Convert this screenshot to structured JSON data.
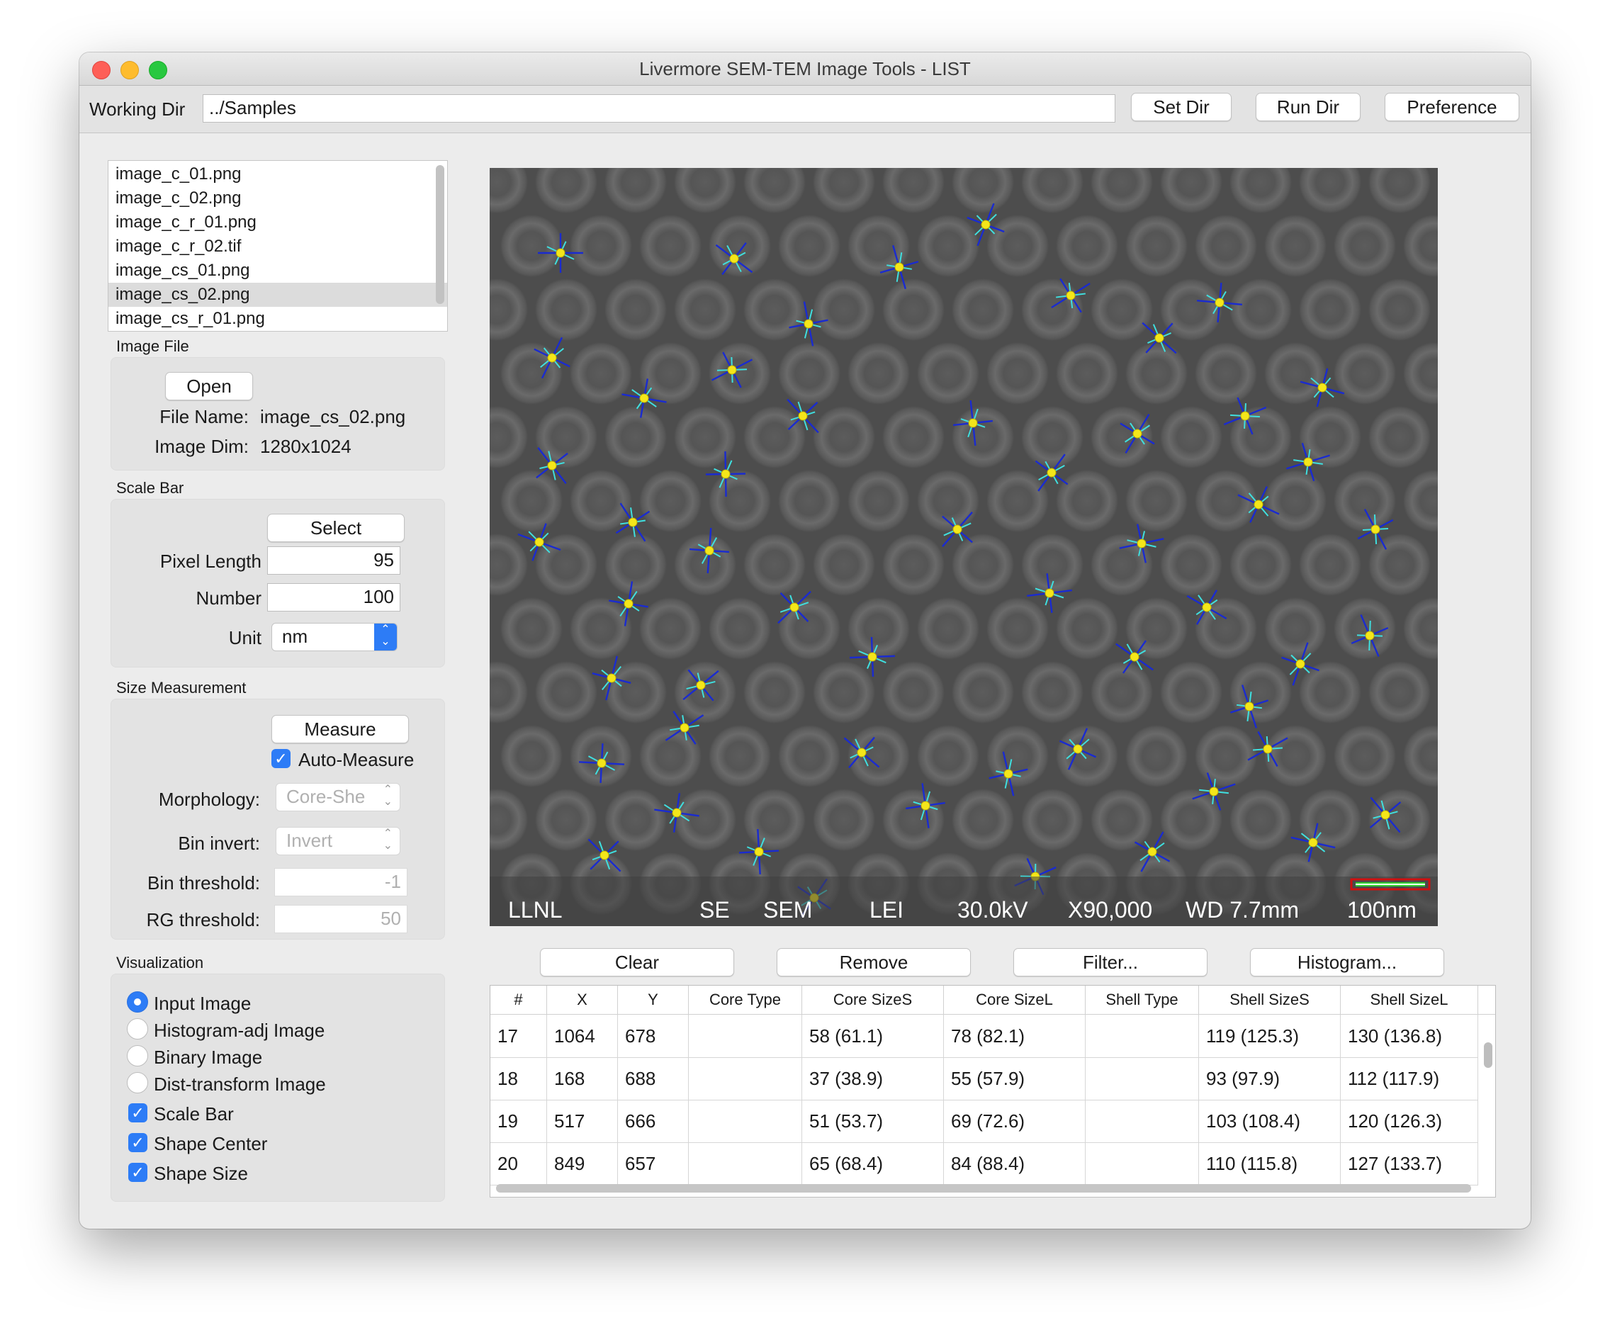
{
  "window": {
    "title": "Livermore SEM-TEM Image Tools - LIST"
  },
  "toolbar": {
    "working_dir_label": "Working Dir",
    "working_dir_value": "../Samples",
    "set_dir": "Set Dir",
    "run_dir": "Run Dir",
    "preference": "Preference"
  },
  "files": [
    "image_c_01.png",
    "image_c_02.png",
    "image_c_r_01.png",
    "image_c_r_02.tif",
    "image_cs_01.png",
    "image_cs_02.png",
    "image_cs_r_01.png"
  ],
  "selected_file": "image_cs_02.png",
  "image_file": {
    "section": "Image File",
    "open": "Open",
    "file_name_label": "File Name:",
    "file_name": "image_cs_02.png",
    "dim_label": "Image Dim:",
    "dim": "1280x1024"
  },
  "scale_bar": {
    "section": "Scale Bar",
    "select": "Select",
    "pixel_length_label": "Pixel Length",
    "pixel_length": "95",
    "number_label": "Number",
    "number": "100",
    "unit_label": "Unit",
    "unit": "nm"
  },
  "size_measurement": {
    "section": "Size Measurement",
    "measure": "Measure",
    "auto_measure": "Auto-Measure",
    "auto_measure_checked": true,
    "morphology_label": "Morphology:",
    "morphology": "Core-She",
    "bin_invert_label": "Bin invert:",
    "bin_invert": "Invert",
    "bin_threshold_label": "Bin threshold:",
    "bin_threshold": "-1",
    "rg_threshold_label": "RG threshold:",
    "rg_threshold": "50"
  },
  "visualization": {
    "section": "Visualization",
    "radios": [
      {
        "label": "Input Image",
        "checked": true
      },
      {
        "label": "Histogram-adj Image",
        "checked": false
      },
      {
        "label": "Binary Image",
        "checked": false
      },
      {
        "label": "Dist-transform Image",
        "checked": false
      }
    ],
    "checks": [
      {
        "label": "Scale Bar",
        "checked": true
      },
      {
        "label": "Shape Center",
        "checked": true
      },
      {
        "label": "Shape Size",
        "checked": true
      }
    ]
  },
  "image_info": {
    "lab": "LLNL",
    "se": "SE",
    "sem": "SEM",
    "lei": "LEI",
    "kv": "30.0kV",
    "mag": "X90,000",
    "wd": "WD 7.7mm",
    "scale": "100nm"
  },
  "actions": {
    "clear": "Clear",
    "remove": "Remove",
    "filter": "Filter...",
    "histogram": "Histogram..."
  },
  "table": {
    "columns": [
      "#",
      "X",
      "Y",
      "Core Type",
      "Core SizeS",
      "Core SizeL",
      "Shell Type",
      "Shell SizeS",
      "Shell SizeL"
    ],
    "rows": [
      [
        "17",
        "1064",
        "678",
        "",
        "58 (61.1)",
        "78 (82.1)",
        "",
        "119 (125.3)",
        "130 (136.8)"
      ],
      [
        "18",
        "168",
        "688",
        "",
        "37 (38.9)",
        "55 (57.9)",
        "",
        "93 (97.9)",
        "112 (117.9)"
      ],
      [
        "19",
        "517",
        "666",
        "",
        "51 (53.7)",
        "69 (72.6)",
        "",
        "103 (108.4)",
        "120 (126.3)"
      ],
      [
        "20",
        "849",
        "657",
        "",
        "65 (68.4)",
        "84 (88.4)",
        "",
        "110 (115.8)",
        "127 (133.7)"
      ]
    ]
  },
  "colors": {
    "accent": "#2d7cf6",
    "image_bg": "#4d4d4d",
    "measure_line_shell": "#1a2bd0",
    "measure_line_core": "#3fe0e0",
    "center_dot": "#f4e61a",
    "scalebar_outline": "#d01010",
    "scalebar_fill": "#30d030"
  }
}
